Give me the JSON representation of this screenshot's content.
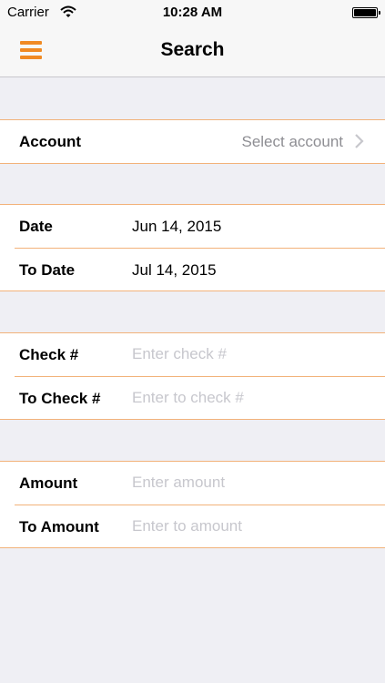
{
  "status": {
    "carrier": "Carrier",
    "time": "10:28 AM"
  },
  "nav": {
    "title": "Search"
  },
  "account": {
    "label": "Account",
    "value": "Select account"
  },
  "dates": {
    "from_label": "Date",
    "from_value": "Jun 14, 2015",
    "to_label": "To Date",
    "to_value": "Jul 14, 2015"
  },
  "check": {
    "from_label": "Check #",
    "from_placeholder": "Enter check #",
    "to_label": "To Check #",
    "to_placeholder": "Enter to check #"
  },
  "amount": {
    "from_label": "Amount",
    "from_placeholder": "Enter amount",
    "to_label": "To Amount",
    "to_placeholder": "Enter to amount"
  },
  "colors": {
    "accent": "#f08a24",
    "separator": "#f2b27a",
    "background": "#efeff4"
  }
}
